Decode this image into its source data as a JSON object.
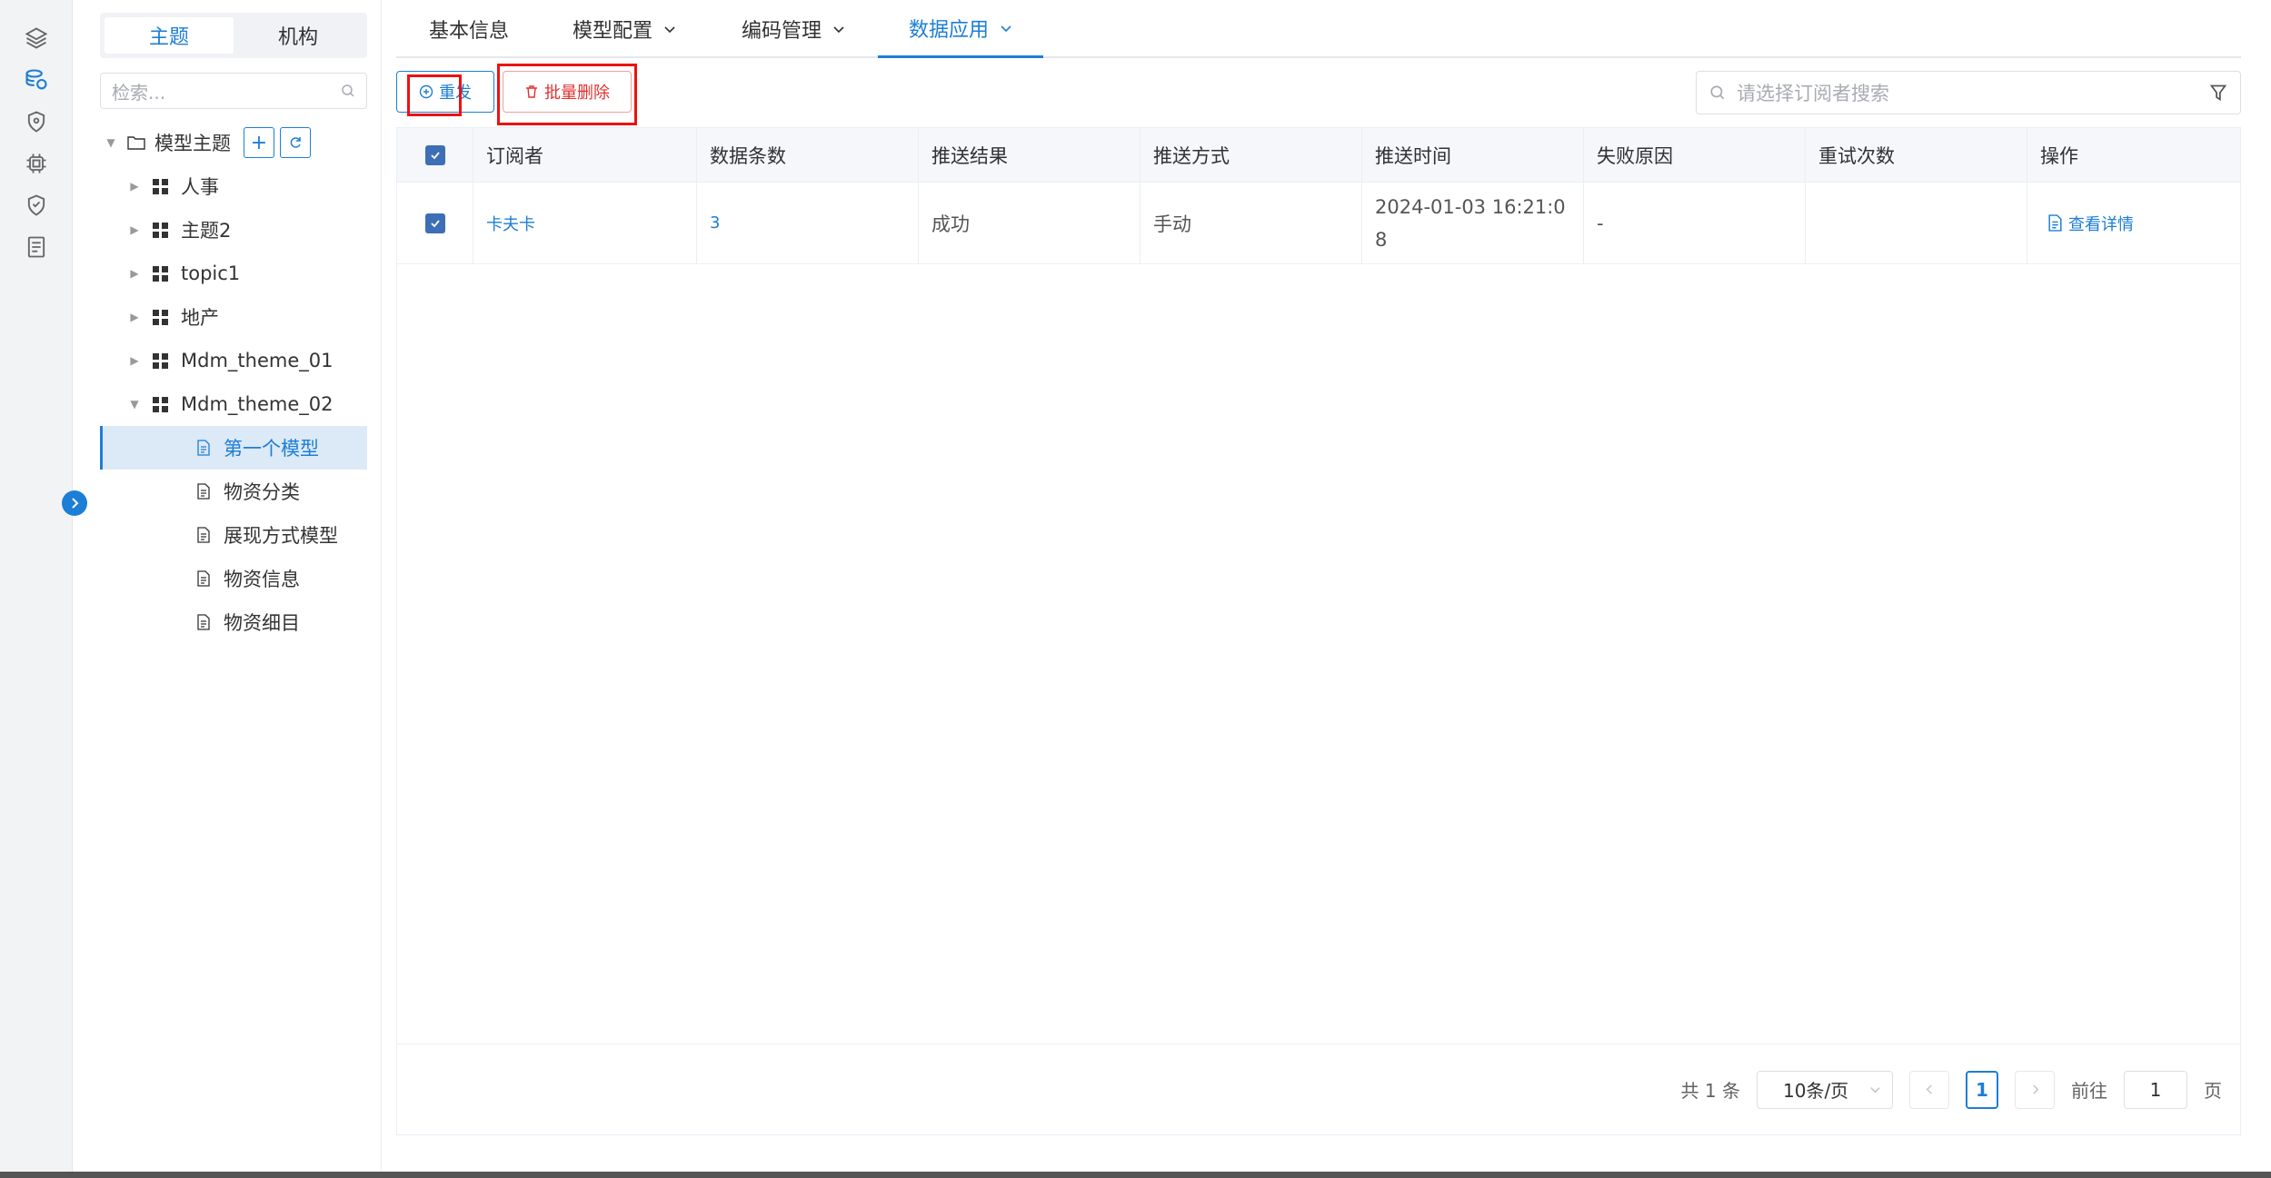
{
  "colors": {
    "accent": "#1c7ed6",
    "danger": "#e03131",
    "highlight": "#ee1111"
  },
  "rail": {
    "icons": [
      "layers-icon",
      "database-icon",
      "shield-icon",
      "chip-icon",
      "security-icon",
      "document-list-icon"
    ]
  },
  "tree": {
    "segments": [
      {
        "label": "主题",
        "active": true
      },
      {
        "label": "机构",
        "active": false
      }
    ],
    "search_placeholder": "检索...",
    "root_label": "模型主题",
    "nodes": [
      {
        "label": "人事",
        "icon": "grid-icon"
      },
      {
        "label": "主题2",
        "icon": "grid-icon"
      },
      {
        "label": "topic1",
        "icon": "grid-icon"
      },
      {
        "label": "地产",
        "icon": "grid-icon"
      },
      {
        "label": "Mdm_theme_01",
        "icon": "grid-icon"
      },
      {
        "label": "Mdm_theme_02",
        "icon": "grid-icon",
        "expanded": true
      }
    ],
    "children": [
      {
        "label": "第一个模型",
        "selected": true
      },
      {
        "label": "物资分类"
      },
      {
        "label": "展现方式模型"
      },
      {
        "label": "物资信息"
      },
      {
        "label": "物资细目"
      }
    ]
  },
  "tabs": [
    {
      "label": "基本信息",
      "dropdown": false
    },
    {
      "label": "模型配置",
      "dropdown": true
    },
    {
      "label": "编码管理",
      "dropdown": true
    },
    {
      "label": "数据应用",
      "dropdown": true,
      "active": true
    }
  ],
  "toolbar": {
    "resend_label": "重发",
    "batch_delete_label": "批量删除",
    "search_placeholder": "请选择订阅者搜索"
  },
  "table": {
    "columns": [
      "订阅者",
      "数据条数",
      "推送结果",
      "推送方式",
      "推送时间",
      "失败原因",
      "重试次数",
      "操作"
    ],
    "rows": [
      {
        "subscriber": "卡夫卡",
        "count": "3",
        "result": "成功",
        "method": "手动",
        "time_line1": "2024-01-03 16:21:0",
        "time_line2": "8",
        "reason": "-",
        "retries": "",
        "action": "查看详情",
        "checked": true
      }
    ]
  },
  "pagination": {
    "total_text": "共 1 条",
    "page_size": "10条/页",
    "current_page": "1",
    "goto_label": "前往",
    "goto_value": "1",
    "page_suffix": "页"
  }
}
